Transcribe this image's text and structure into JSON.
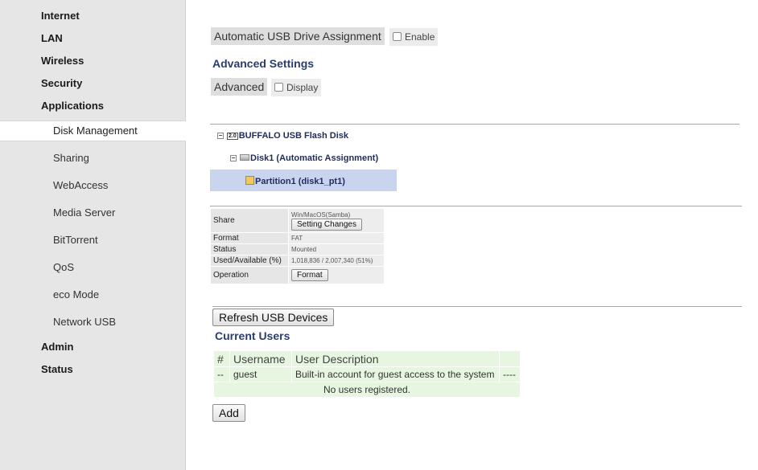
{
  "sidebar": {
    "items": [
      {
        "label": "Internet"
      },
      {
        "label": "LAN"
      },
      {
        "label": "Wireless"
      },
      {
        "label": "Security"
      },
      {
        "label": "Applications"
      }
    ],
    "sub_items": [
      {
        "label": "Disk Management",
        "active": true
      },
      {
        "label": "Sharing"
      },
      {
        "label": "WebAccess"
      },
      {
        "label": "Media Server"
      },
      {
        "label": "BitTorrent"
      },
      {
        "label": "QoS"
      },
      {
        "label": "eco Mode"
      },
      {
        "label": "Network USB"
      }
    ],
    "bottom_items": [
      {
        "label": "Admin"
      },
      {
        "label": "Status"
      }
    ]
  },
  "auto_assign": {
    "label": "Automatic USB Drive Assignment",
    "checkbox_label": "Enable",
    "checked": false
  },
  "advanced_settings": {
    "title": "Advanced Settings",
    "label": "Advanced",
    "checkbox_label": "Display",
    "checked": false
  },
  "tree": {
    "device_badge": "2.0",
    "device": "BUFFALO USB Flash Disk",
    "disk": "Disk1 (Automatic Assignment)",
    "partition": "Partition1 (disk1_pt1)"
  },
  "partition_info": {
    "share_label": "Share",
    "share_value": "Win/MacOS(Samba)",
    "setting_changes_button": "Setting Changes",
    "format_label": "Format",
    "format_value": "FAT",
    "status_label": "Status",
    "status_value": "Mounted",
    "used_label": "Used/Available (%)",
    "used_value": "1,018,836 / 2,007,340 (51%)",
    "operation_label": "Operation",
    "format_button": "Format"
  },
  "refresh_button": "Refresh USB Devices",
  "current_users": {
    "title": "Current Users",
    "columns": [
      "#",
      "Username",
      "User Description",
      ""
    ],
    "rows": [
      {
        "num": "--",
        "username": "guest",
        "description": "Built-in account for guest access to the system",
        "extra": "----"
      }
    ],
    "empty_message": "No users registered.",
    "add_button": "Add"
  },
  "colors": {
    "accent_title": "#2b3c6e",
    "sidebar_bg": "#e6e6e6",
    "users_table_bg": "#e7f6e1",
    "tree_selected_bg": "#c9d4ee"
  }
}
